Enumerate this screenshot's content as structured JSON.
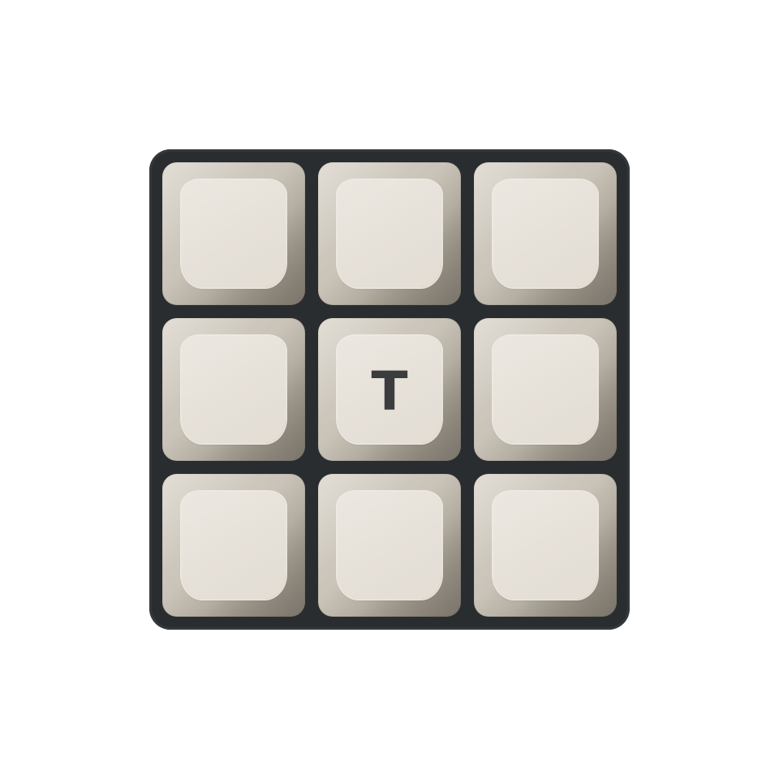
{
  "keypad": {
    "keys": [
      {
        "label": ""
      },
      {
        "label": ""
      },
      {
        "label": ""
      },
      {
        "label": ""
      },
      {
        "label": "T"
      },
      {
        "label": ""
      },
      {
        "label": ""
      },
      {
        "label": ""
      },
      {
        "label": ""
      }
    ]
  },
  "colors": {
    "frame": "#2a2d30",
    "key_body": "#c9c3b8",
    "key_top": "#e6e1d9",
    "legend": "#3b3c3e",
    "background": "#ffffff"
  }
}
